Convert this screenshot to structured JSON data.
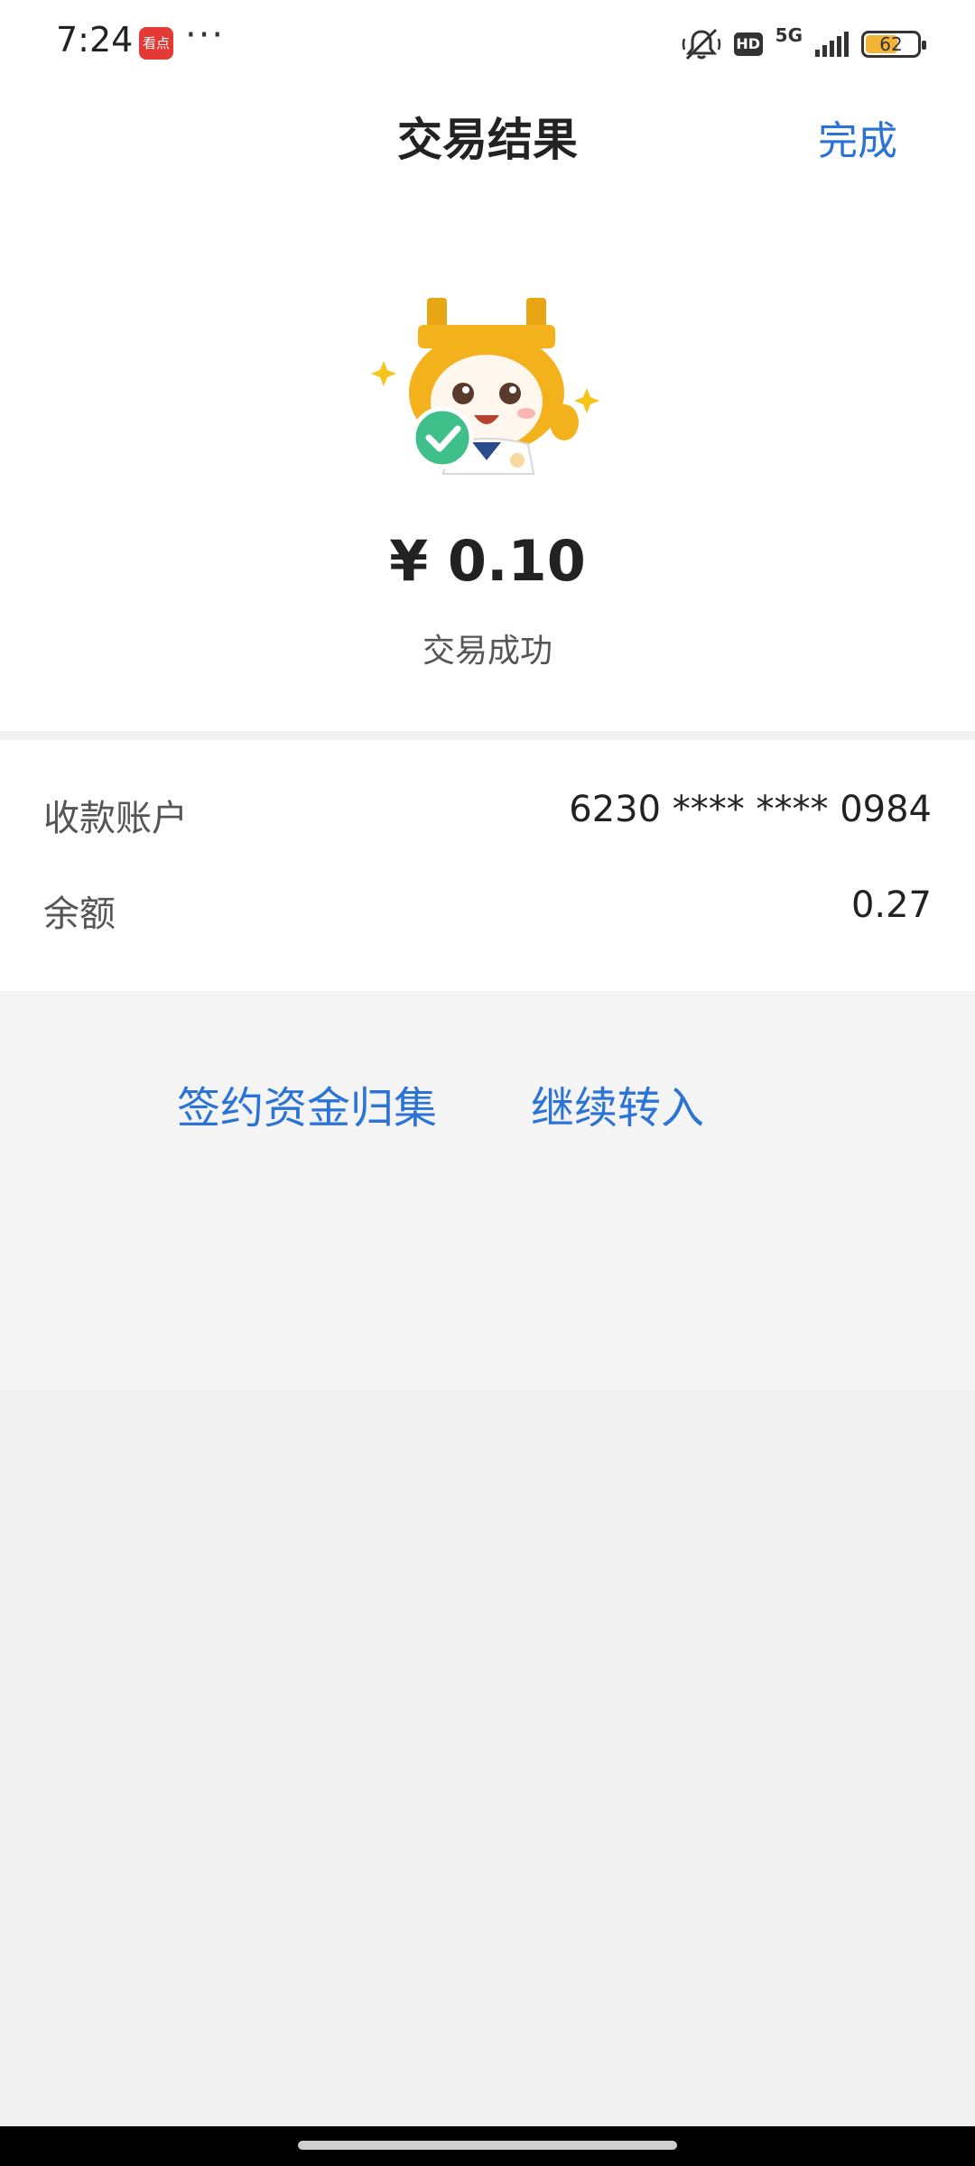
{
  "status_bar": {
    "time": "7:24",
    "app_badge": "看点",
    "dots": "···",
    "hd": "HD",
    "network": "5G",
    "battery": "62",
    "battery_level": 0.62
  },
  "nav": {
    "title": "交易结果",
    "done_label": "完成"
  },
  "result": {
    "amount": "¥ 0.10",
    "status": "交易成功"
  },
  "details": [
    {
      "label": "收款账户",
      "value": "6230 **** **** 0984"
    },
    {
      "label": "余额",
      "value": "0.27"
    }
  ],
  "actions": {
    "sign_label": "签约资金归集",
    "continue_label": "继续转入"
  },
  "colors": {
    "accent": "#2b73d6",
    "success": "#3fbf8a",
    "mascot_gold": "#f3b21c"
  }
}
